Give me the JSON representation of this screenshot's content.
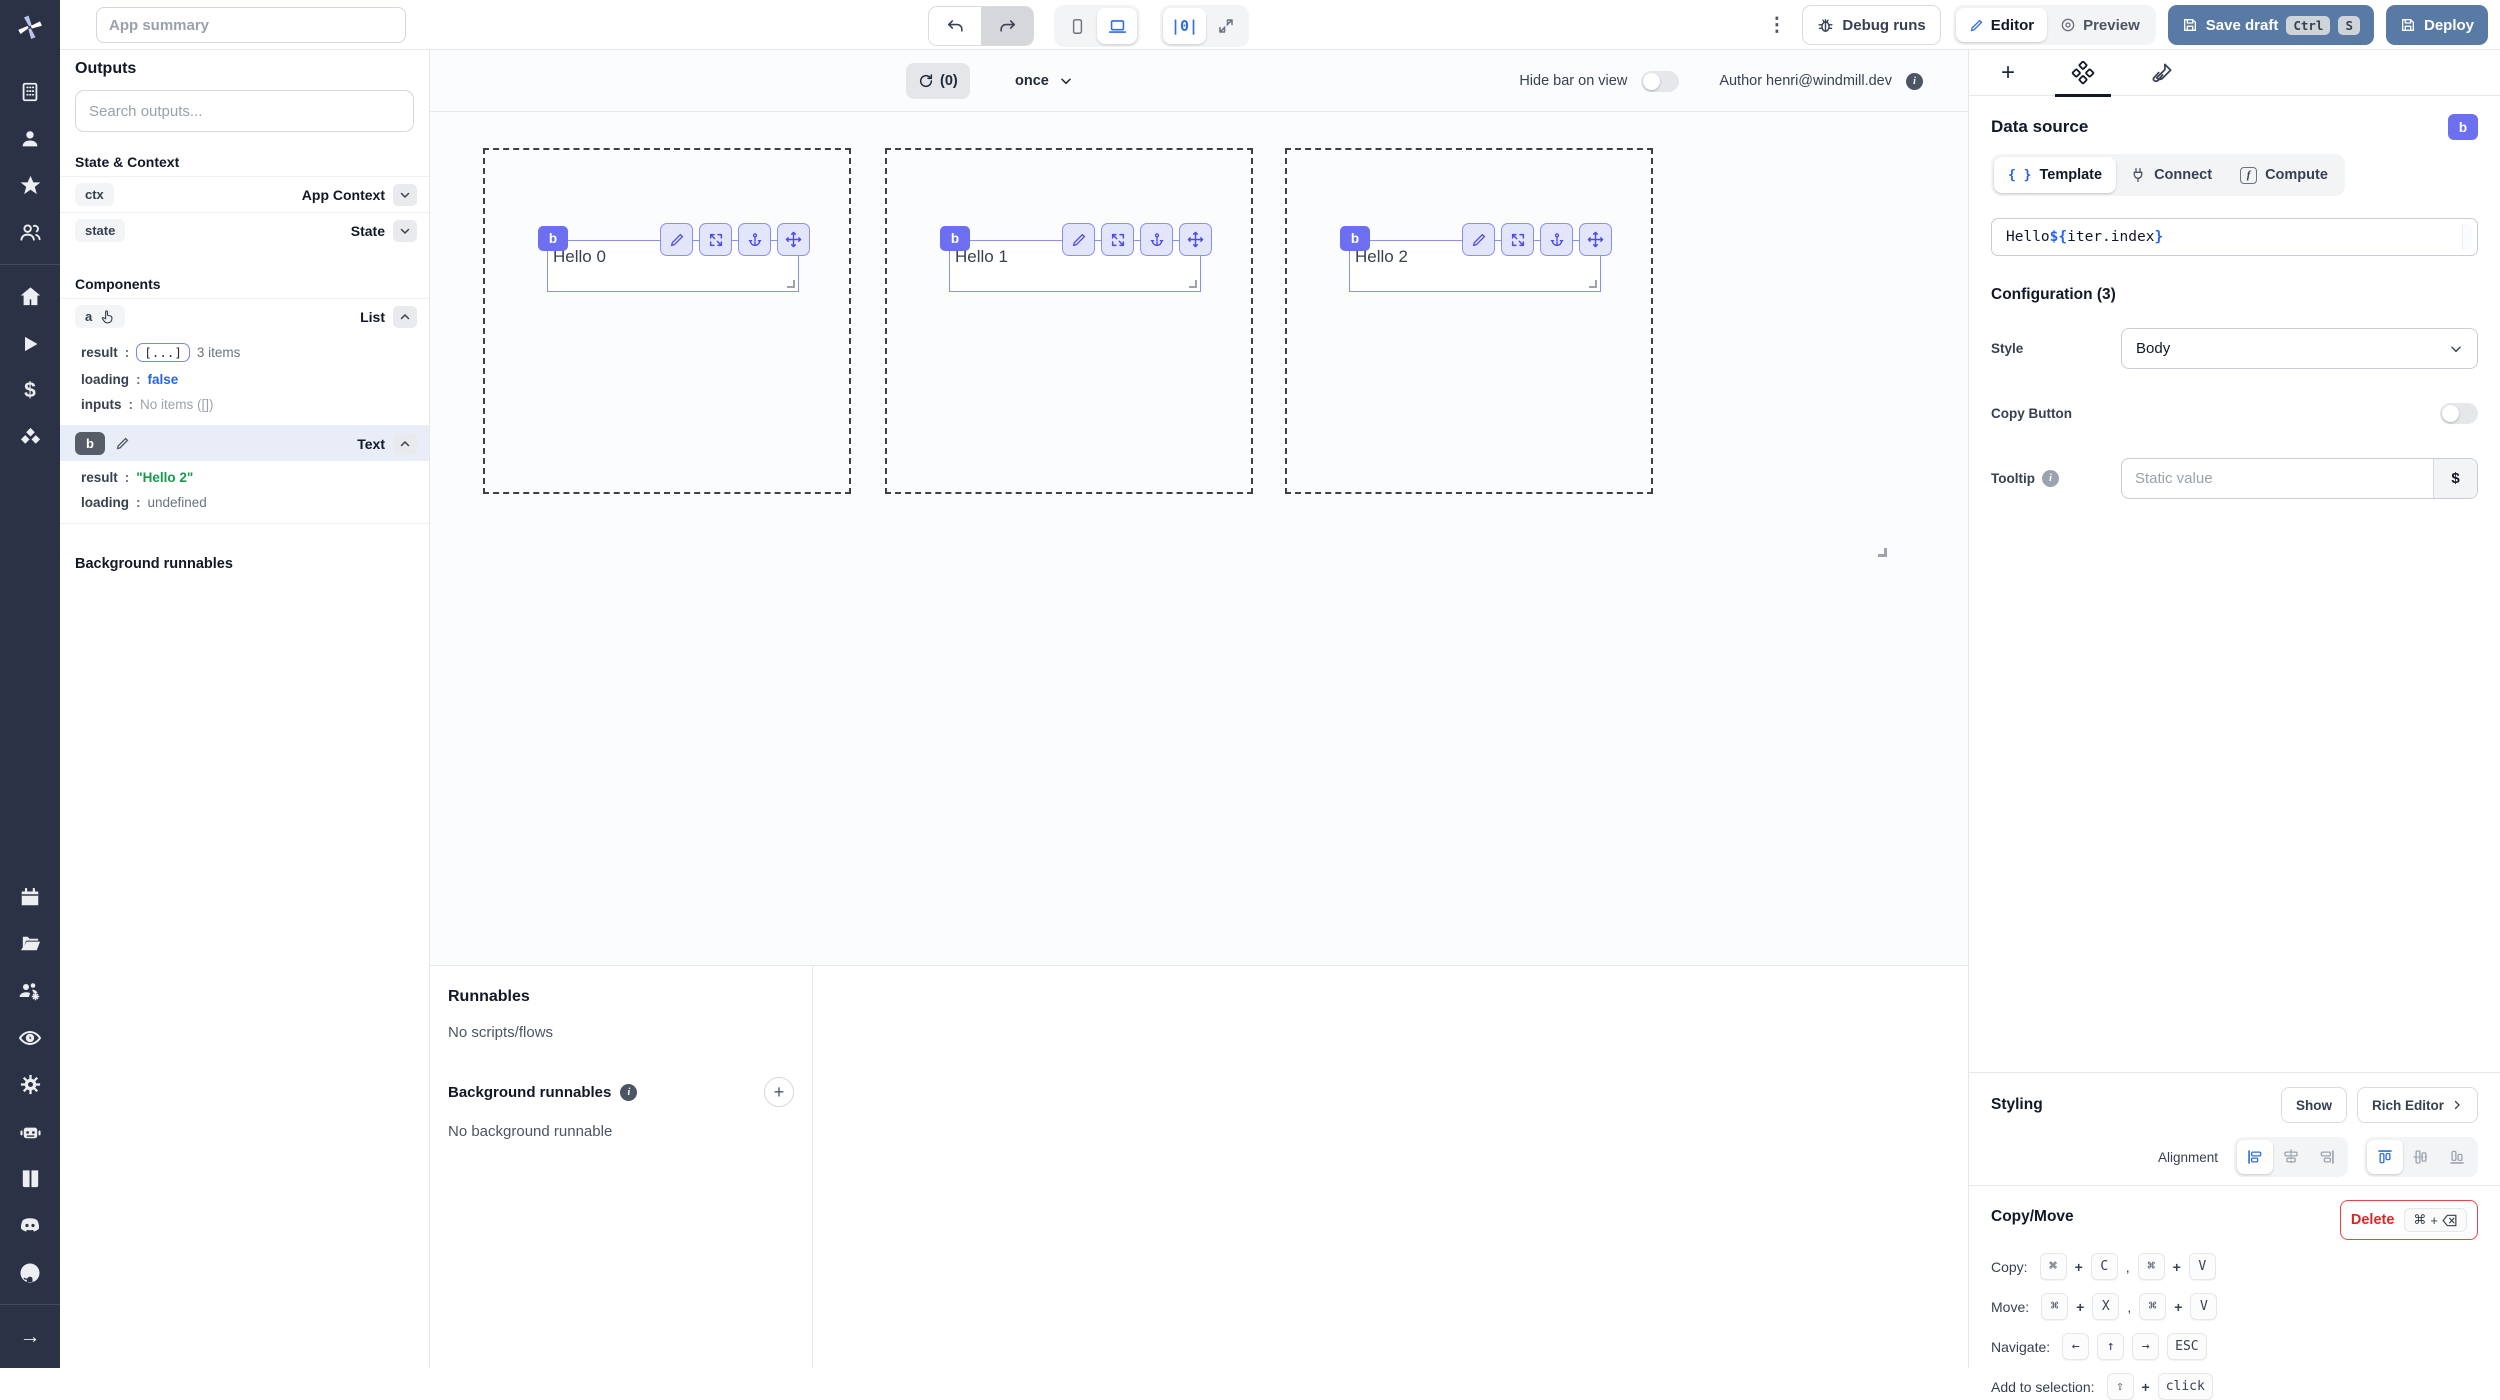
{
  "topbar": {
    "app_summary_placeholder": "App summary",
    "debug_runs": "Debug runs",
    "editor": "Editor",
    "preview": "Preview",
    "save_draft": "Save draft",
    "save_key_1": "Ctrl",
    "save_key_2": "S",
    "deploy": "Deploy"
  },
  "icons": {
    "dots_vertical": "⋮",
    "guides": "|0|",
    "plus": "+",
    "braces": "{ }",
    "fx": "f",
    "arrow_right": "→",
    "dollar": "$"
  },
  "outputs_panel": {
    "title": "Outputs",
    "search_placeholder": "Search outputs...",
    "state_context_heading": "State & Context",
    "ctx_id": "ctx",
    "ctx_type": "App Context",
    "state_id": "state",
    "state_type": "State",
    "components_heading": "Components",
    "a": {
      "id": "a",
      "type": "List",
      "result_key": "result",
      "result_chip": "[...]",
      "result_suffix": "3 items",
      "loading_key": "loading",
      "loading_value": "false",
      "inputs_key": "inputs",
      "inputs_value": "No items ([])"
    },
    "b": {
      "id": "b",
      "type": "Text",
      "result_key": "result",
      "result_value": "\"Hello 2\"",
      "loading_key": "loading",
      "loading_value": "undefined"
    },
    "background_runnables": "Background runnables",
    "colon": ":"
  },
  "canvas": {
    "refresh_count": "(0)",
    "schedule": "once",
    "hide_bar_label": "Hide bar on view",
    "author": "Author henri@windmill.dev",
    "items": [
      {
        "badge": "b",
        "text": "Hello 0"
      },
      {
        "badge": "b",
        "text": "Hello 1"
      },
      {
        "badge": "b",
        "text": "Hello 2"
      }
    ]
  },
  "runnables_panel": {
    "title": "Runnables",
    "empty": "No scripts/flows",
    "bg_title": "Background runnables",
    "bg_empty": "No background runnable"
  },
  "settings_panel": {
    "data_source": "Data source",
    "badge": "b",
    "tab_template": "Template",
    "tab_connect": "Connect",
    "tab_compute": "Compute",
    "code_prefix": "Hello ",
    "code_open": "${",
    "code_expr": "iter.index",
    "code_close": "}",
    "configuration": "Configuration (3)",
    "style_label": "Style",
    "style_value": "Body",
    "copy_button_label": "Copy Button",
    "tooltip_label": "Tooltip",
    "tooltip_placeholder": "Static value",
    "tooltip_suffix": "$",
    "styling_heading": "Styling",
    "show": "Show",
    "rich_editor": "Rich Editor",
    "alignment_label": "Alignment",
    "copy_move_heading": "Copy/Move",
    "delete": "Delete",
    "shortcuts": {
      "copy_label": "Copy:",
      "move_label": "Move:",
      "navigate_label": "Navigate:",
      "add_label": "Add to selection:",
      "cmd": "⌘",
      "plus": "+",
      "comma": ",",
      "c": "C",
      "v": "V",
      "x": "X",
      "left": "←",
      "up": "↑",
      "right": "→",
      "esc": "ESC",
      "shift": "⇧",
      "click": "click"
    }
  }
}
